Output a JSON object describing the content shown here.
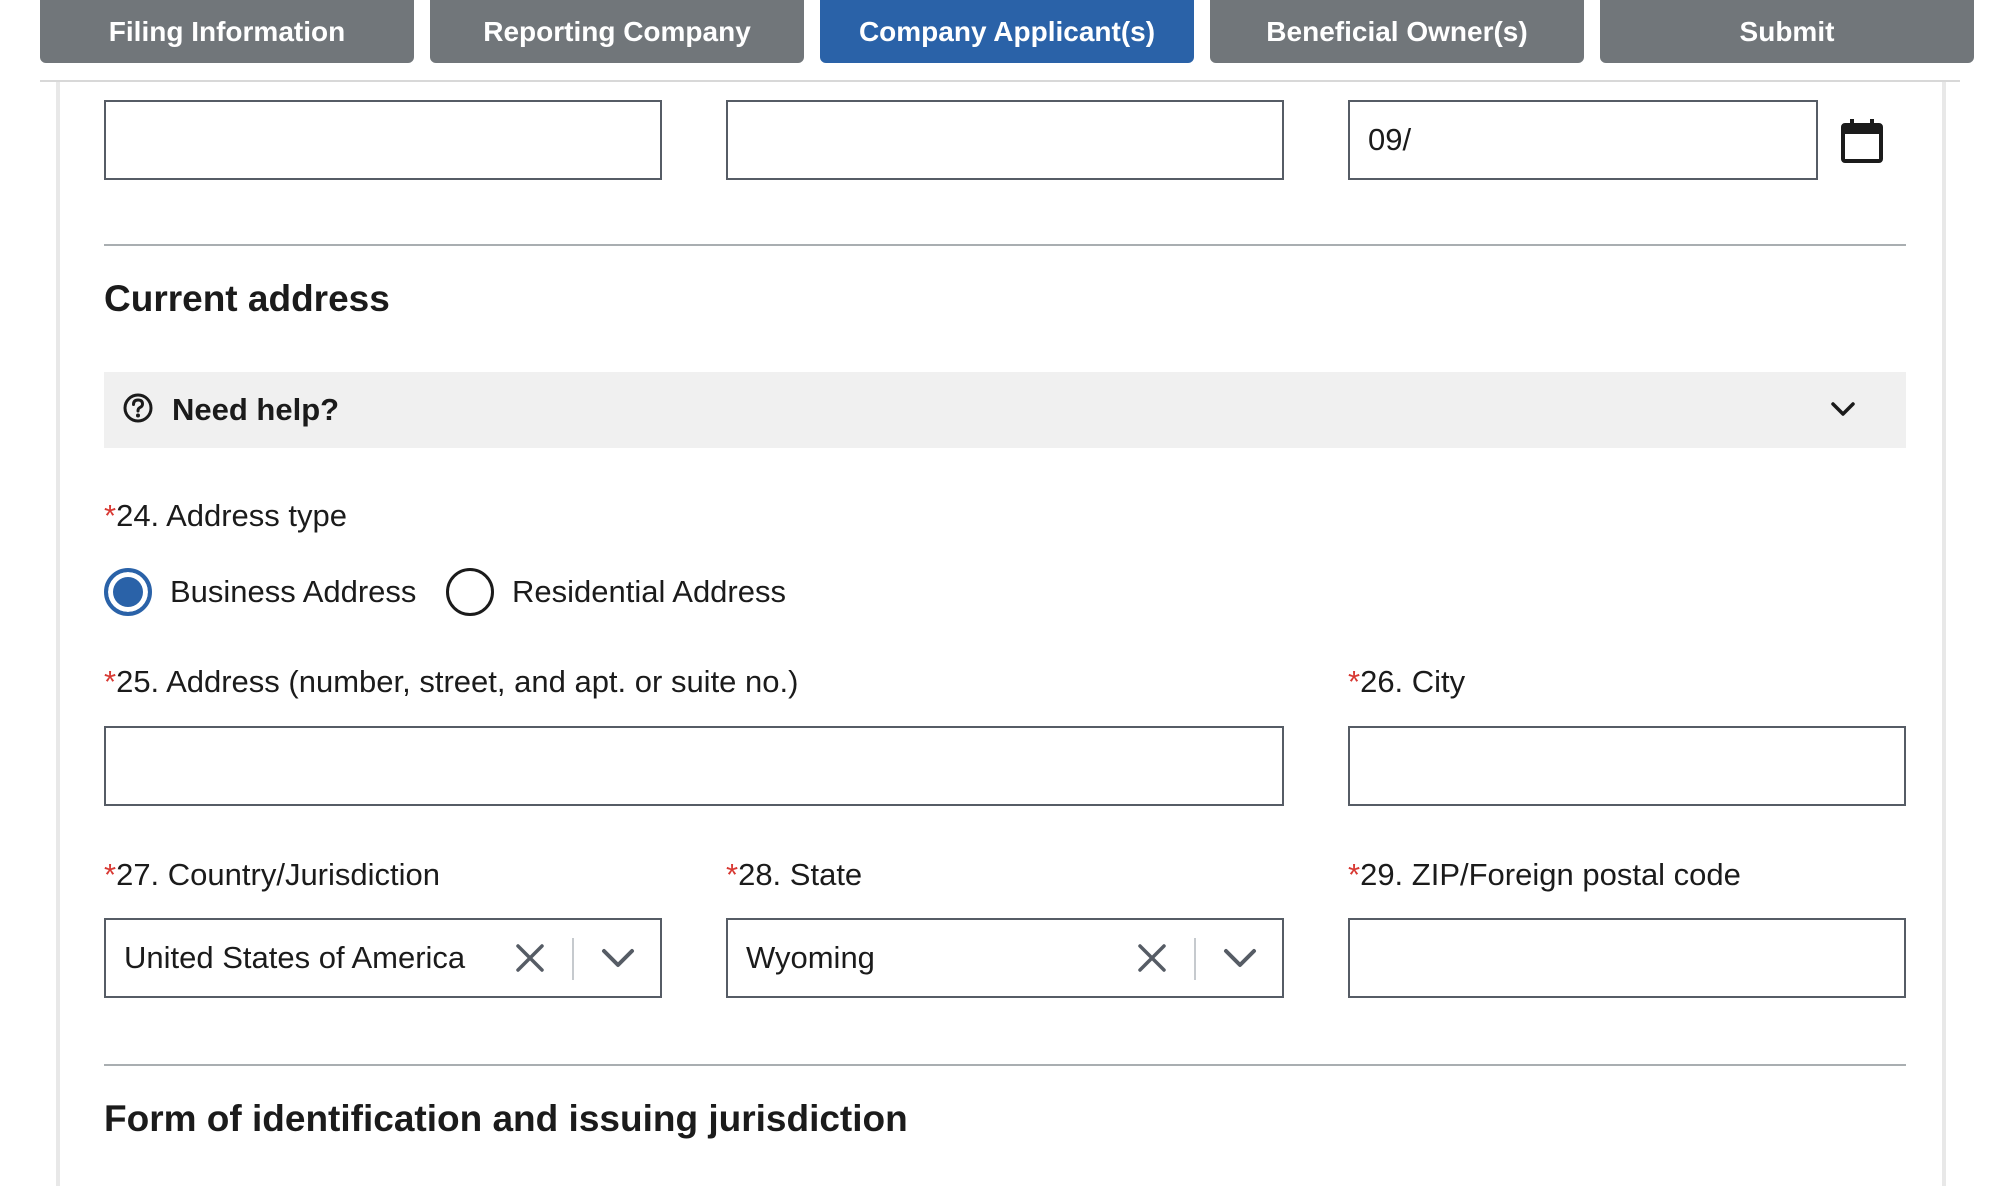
{
  "tabs": [
    {
      "label": "Filing Information",
      "active": false
    },
    {
      "label": "Reporting Company",
      "active": false
    },
    {
      "label": "Company Applicant(s)",
      "active": true
    },
    {
      "label": "Beneficial Owner(s)",
      "active": false
    },
    {
      "label": "Submit",
      "active": false
    }
  ],
  "top_row": {
    "field1_value": "",
    "field2_value": "",
    "date_value": "09/",
    "calendar_icon": "calendar-icon"
  },
  "current_address": {
    "title": "Current address",
    "help": {
      "label": "Need help?",
      "icon": "question-circle-icon",
      "toggle_icon": "chevron-down-icon"
    },
    "address_type": {
      "required_mark": "*",
      "label": "24. Address type",
      "options": [
        {
          "label": "Business Address",
          "checked": true
        },
        {
          "label": "Residential Address",
          "checked": false
        }
      ]
    },
    "address": {
      "required_mark": "*",
      "label": "25. Address (number, street, and apt. or suite no.)",
      "value": ""
    },
    "city": {
      "required_mark": "*",
      "label": "26. City",
      "value": ""
    },
    "country": {
      "required_mark": "*",
      "label": "27. Country/Jurisdiction",
      "value": "United States of America",
      "clear_icon": "x-icon",
      "toggle_icon": "chevron-down-icon"
    },
    "state": {
      "required_mark": "*",
      "label": "28. State",
      "value": "Wyoming",
      "clear_icon": "x-icon",
      "toggle_icon": "chevron-down-icon"
    },
    "zip": {
      "required_mark": "*",
      "label": "29. ZIP/Foreign postal code",
      "value": ""
    }
  },
  "identification": {
    "title": "Form of identification and issuing jurisdiction"
  },
  "colors": {
    "tab_inactive": "#71767a",
    "tab_active": "#2a62a8",
    "required": "#d83933",
    "help_background": "#f0f0f0",
    "radio_checked": "#2a62a8"
  }
}
